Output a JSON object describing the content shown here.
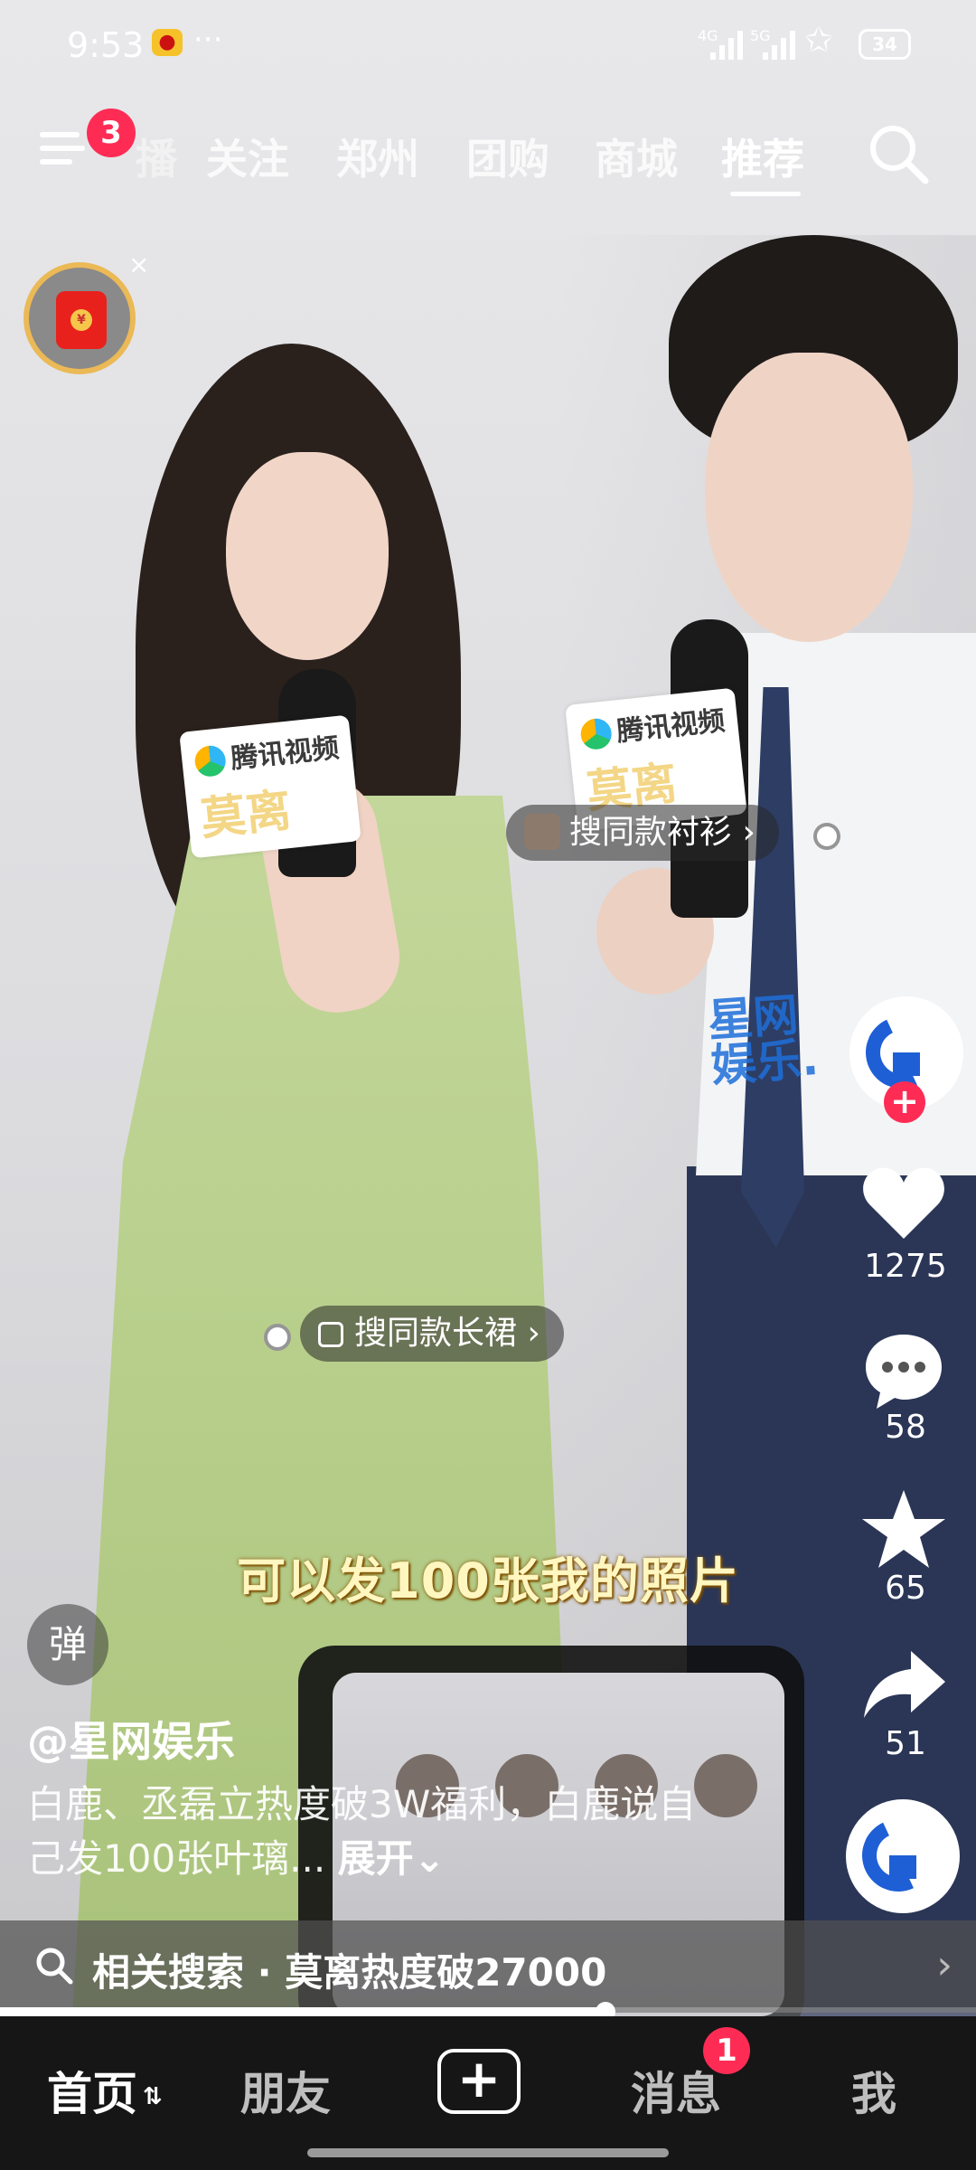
{
  "status_bar": {
    "time": "9:53",
    "more": "···",
    "net1": "4G",
    "net2": "5G",
    "battery": "34"
  },
  "top_nav": {
    "menu_badge": "3",
    "tabs": [
      "播",
      "关注",
      "郑州",
      "团购",
      "商城",
      "推荐"
    ],
    "active_tab": "推荐"
  },
  "video": {
    "mic_brand": "腾讯视频",
    "mic_show": "莫离",
    "watermark_line1": "星网",
    "watermark_line2": "娱乐.",
    "caption": "可以发100张我的照片"
  },
  "red_packet": {
    "close": "×"
  },
  "search_tags": {
    "shirt": "搜同款衬衫 ›",
    "skirt": "搜同款长裙 ›"
  },
  "right_rail": {
    "likes": "1275",
    "comments": "58",
    "favorites": "65",
    "shares": "51",
    "follow_plus": "+"
  },
  "post": {
    "danmu": "弹",
    "author": "@星网娱乐",
    "desc": "白鹿、丞磊立热度破3W福利，白鹿说自己发100张叶璃...",
    "expand": "展开⌄"
  },
  "related_search": {
    "label": "相关搜索 · 莫离热度破27000",
    "chevron": "›"
  },
  "playback": {
    "progress": 0.62
  },
  "bottom_nav": {
    "home": "首页",
    "home_arrows": "⇅",
    "friends": "朋友",
    "create": "+",
    "messages": "消息",
    "messages_badge": "1",
    "me": "我"
  },
  "colors": {
    "accent": "#fe2c55",
    "dress": "#b8cf8c",
    "caption": "#fff6c0"
  }
}
